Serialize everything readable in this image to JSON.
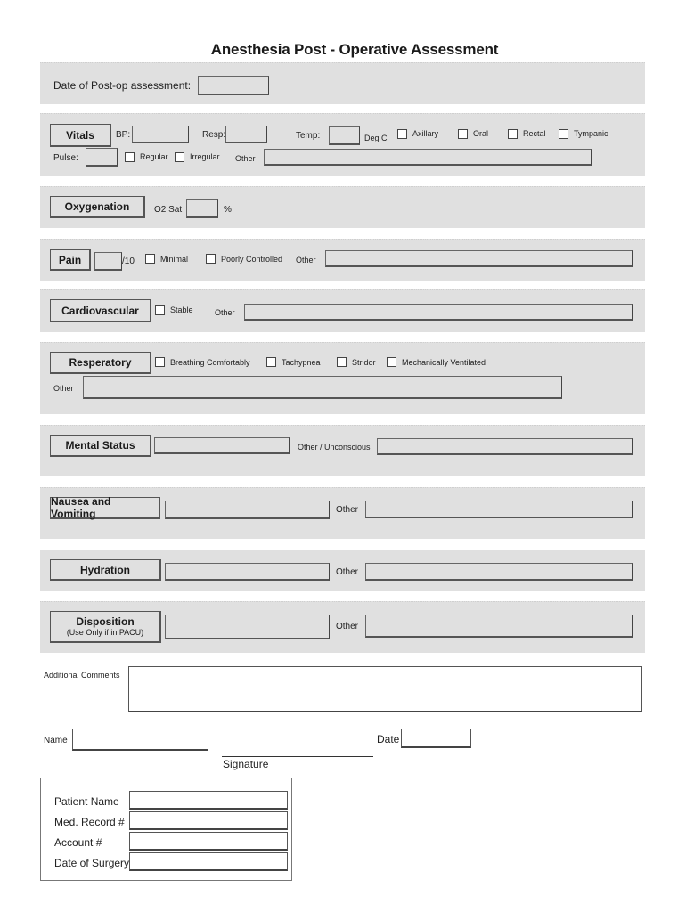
{
  "title": "Anesthesia  Post - Operative Assessment",
  "date_section": {
    "label": "Date of Post-op assessment:",
    "value": ""
  },
  "vitals": {
    "header": "Vitals",
    "bp_label": "BP:",
    "bp_value": "",
    "resp_label": "Resp:",
    "resp_value": "",
    "temp_label": "Temp:",
    "temp_value": "",
    "temp_unit": "Deg C",
    "temp_methods": [
      {
        "label": "Axillary",
        "checked": false
      },
      {
        "label": "Oral",
        "checked": false
      },
      {
        "label": "Rectal",
        "checked": false
      },
      {
        "label": "Tympanic",
        "checked": false
      }
    ],
    "pulse_label": "Pulse:",
    "pulse_value": "",
    "pulse_types": [
      {
        "label": "Regular",
        "checked": false
      },
      {
        "label": "Irregular",
        "checked": false
      }
    ],
    "other_label": "Other",
    "other_value": ""
  },
  "oxygenation": {
    "header": "Oxygenation",
    "o2_label": "O2 Sat",
    "o2_value": "",
    "unit": "%"
  },
  "pain": {
    "header": "Pain",
    "score_value": "",
    "scale": "/10",
    "options": [
      {
        "label": "Minimal",
        "checked": false
      },
      {
        "label": "Poorly Controlled",
        "checked": false
      }
    ],
    "other_label": "Other",
    "other_value": ""
  },
  "cardiovascular": {
    "header": "Cardiovascular",
    "options": [
      {
        "label": "Stable",
        "checked": false
      }
    ],
    "other_label": "Other",
    "other_value": ""
  },
  "respiratory": {
    "header": "Resperatory",
    "options": [
      {
        "label": "Breathing Comfortably",
        "checked": false
      },
      {
        "label": "Tachypnea",
        "checked": false
      },
      {
        "label": "Stridor",
        "checked": false
      },
      {
        "label": "Mechanically Ventilated",
        "checked": false
      }
    ],
    "other_label": "Other",
    "other_value": ""
  },
  "mental_status": {
    "header": "Mental Status",
    "value": "",
    "other_label": "Other / Unconscious",
    "other_value": ""
  },
  "nausea": {
    "header": "Nausea and Vomiting",
    "value": "",
    "other_label": "Other",
    "other_value": ""
  },
  "hydration": {
    "header": "Hydration",
    "value": "",
    "other_label": "Other",
    "other_value": ""
  },
  "disposition": {
    "header": "Disposition",
    "subheader": "(Use Only if in PACU)",
    "value": "",
    "other_label": "Other",
    "other_value": ""
  },
  "comments": {
    "label": "Additional Comments",
    "value": ""
  },
  "signoff": {
    "name_label": "Name",
    "name_value": "",
    "signature_label": "Signature",
    "date_label": "Date",
    "date_value": ""
  },
  "patient": {
    "fields": [
      {
        "label": "Patient Name",
        "value": ""
      },
      {
        "label": "Med. Record #",
        "value": ""
      },
      {
        "label": "Account #",
        "value": ""
      },
      {
        "label": "Date of Surgery",
        "value": ""
      }
    ]
  }
}
